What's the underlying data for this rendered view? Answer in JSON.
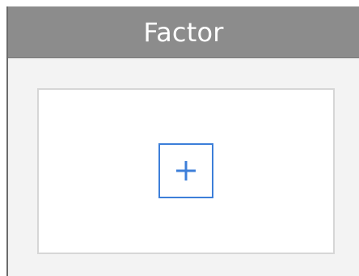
{
  "panel": {
    "title": "Factor",
    "add_icon": "plus-icon"
  },
  "colors": {
    "header_bg": "#8c8c8c",
    "accent": "#3d7fd9"
  }
}
